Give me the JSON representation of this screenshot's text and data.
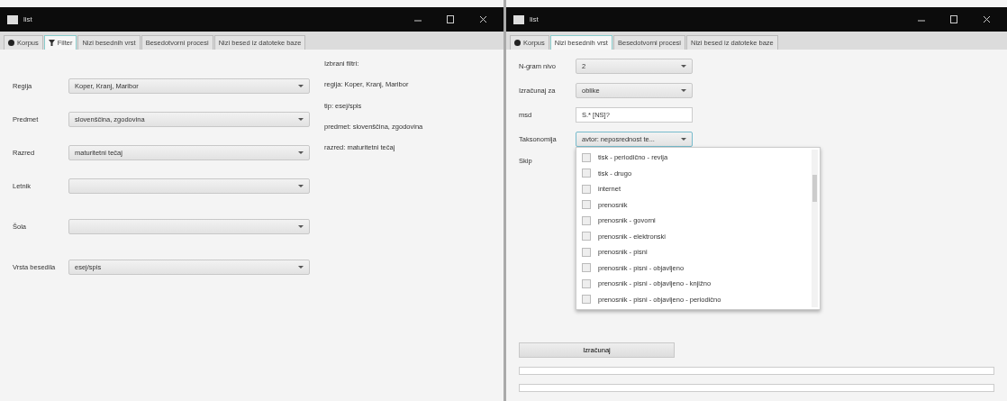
{
  "windows": [
    {
      "title": "list",
      "kind": "filter",
      "tabs": [
        {
          "label": "Korpus",
          "kind": "corpus",
          "selected": false
        },
        {
          "label": "Filter",
          "kind": "filter",
          "selected": true
        },
        {
          "label": "Nizi besednih vrst",
          "selected": false
        },
        {
          "label": "Besedotvorni procesi",
          "selected": false
        },
        {
          "label": "Nizi besed iz datoteke baze",
          "selected": false
        }
      ],
      "fields": [
        {
          "label": "Regija",
          "value": "Koper, Kranj, Maribor"
        },
        {
          "label": "Predmet",
          "value": "slovenščina, zgodovina"
        },
        {
          "label": "Razred",
          "value": "maturitetni tečaj"
        },
        {
          "label": "Letnik"
        },
        {
          "label": "Šola"
        },
        {
          "label": "Vrsta besedila",
          "value": "esej/spis"
        }
      ],
      "summary": [
        "Izbrani filtri:",
        "regija: Koper, Kranj, Maribor",
        "tip: esej/spis",
        "predmet: slovenščina, zgodovina",
        "razred: maturitetni tečaj"
      ]
    },
    {
      "title": "list",
      "kind": "ngram",
      "tabs": [
        {
          "label": "Korpus",
          "kind": "corpus",
          "selected": false
        },
        {
          "label": "Nizi besednih vrst",
          "selected": true
        },
        {
          "label": "Besedotvorni procesi",
          "selected": false
        },
        {
          "label": "Nizi besed iz datoteke baze",
          "selected": false
        }
      ],
      "fields": [
        {
          "label": "N-gram nivo",
          "kind": "select",
          "value": "2"
        },
        {
          "label": "Izračunaj za",
          "kind": "select",
          "value": "oblike"
        },
        {
          "label": "msd",
          "kind": "text",
          "value": "S.* [NS]?"
        },
        {
          "label": "Taksonomija",
          "kind": "select",
          "value": "avtor: neposrednost te...",
          "focused": true
        },
        {
          "label": "Skip",
          "kind": "label"
        }
      ],
      "dropdown": [
        {
          "label": "tisk - periodično - revija",
          "checked": false
        },
        {
          "label": "tisk - drugo",
          "checked": false
        },
        {
          "label": "internet",
          "checked": false
        },
        {
          "label": "prenosnik",
          "checked": false
        },
        {
          "label": "prenosnik - govorni",
          "checked": false
        },
        {
          "label": "prenosnik - elektronski",
          "checked": false
        },
        {
          "label": "prenosnik - pisni",
          "checked": false
        },
        {
          "label": "prenosnik - pisni - objavljeno",
          "checked": false
        },
        {
          "label": "prenosnik - pisni - objavljeno - knjižno",
          "checked": false
        },
        {
          "label": "prenosnik - pisni - objavljeno - periodično",
          "checked": false
        }
      ],
      "button": "Izračunaj"
    }
  ]
}
